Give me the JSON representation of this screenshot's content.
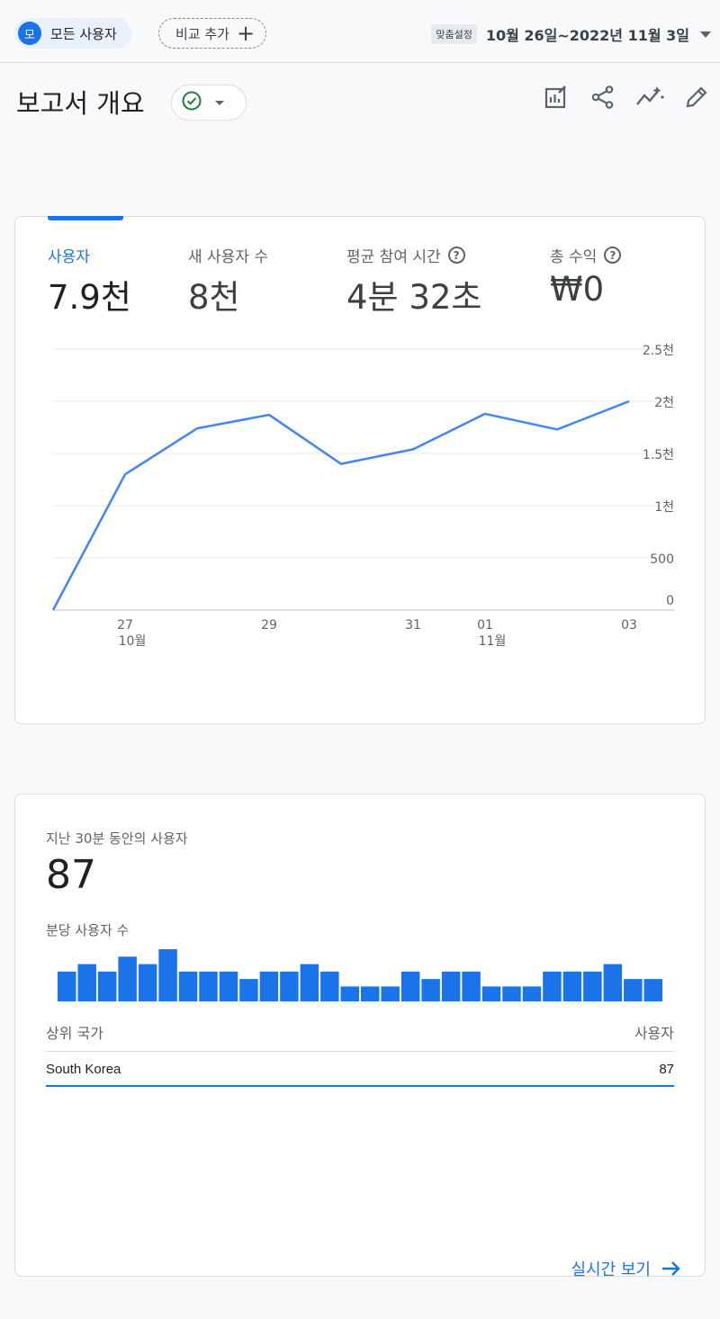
{
  "topbar": {
    "segment_avatar": "모",
    "segment_label": "모든 사용자",
    "add_comparison_label": "비교 추가",
    "add_comparison_icon": "plus-icon",
    "custom_badge": "맞춤설정",
    "date_range": "10월 26일~2022년 11월 3일"
  },
  "header": {
    "title": "보고서 개요",
    "status_icon": "check-circle-icon",
    "tools": [
      "customize-report-icon",
      "share-icon",
      "insights-icon",
      "edit-icon"
    ]
  },
  "metrics": [
    {
      "label": "사용자",
      "value": "7.9천",
      "active": true,
      "help": false
    },
    {
      "label": "새 사용자 수",
      "value": "8천",
      "active": false,
      "help": false
    },
    {
      "label": "평균 참여 시간",
      "value": "4분 32초",
      "active": false,
      "help": true
    },
    {
      "label": "총 수익",
      "value": "₩0",
      "active": false,
      "help": true
    }
  ],
  "chart_data": {
    "type": "line",
    "x": [
      "26",
      "27",
      "28",
      "29",
      "30",
      "31",
      "01",
      "02",
      "03"
    ],
    "x_tick_labels": [
      {
        "day": "27",
        "month": "10월"
      },
      {
        "day": "29",
        "month": ""
      },
      {
        "day": "31",
        "month": ""
      },
      {
        "day": "01",
        "month": "11월"
      },
      {
        "day": "03",
        "month": ""
      }
    ],
    "series": [
      {
        "values": [
          0,
          1300,
          1740,
          1870,
          1400,
          1540,
          1880,
          1730,
          2000
        ]
      }
    ],
    "y_ticks": [
      0,
      500,
      1000,
      1500,
      2000,
      2500
    ],
    "y_tick_labels": [
      "0",
      "500",
      "1천",
      "1.5천",
      "2천",
      "2.5천"
    ],
    "ylim": [
      0,
      2500
    ],
    "grid": true,
    "color": "#4285f4"
  },
  "realtime": {
    "label": "지난 30분 동안의 사용자",
    "value": "87",
    "per_minute_label": "분당 사용자 수",
    "per_minute_values": [
      4,
      5,
      4,
      6,
      5,
      7,
      4,
      4,
      4,
      3,
      4,
      4,
      5,
      4,
      2,
      2,
      2,
      4,
      3,
      4,
      4,
      2,
      2,
      2,
      4,
      4,
      4,
      5,
      3,
      3
    ],
    "table_header_country": "상위 국가",
    "table_header_users": "사용자",
    "rows": [
      {
        "country": "South Korea",
        "users": "87"
      }
    ],
    "link_label": "실시간 보기",
    "bar_color": "#1a73e8"
  }
}
